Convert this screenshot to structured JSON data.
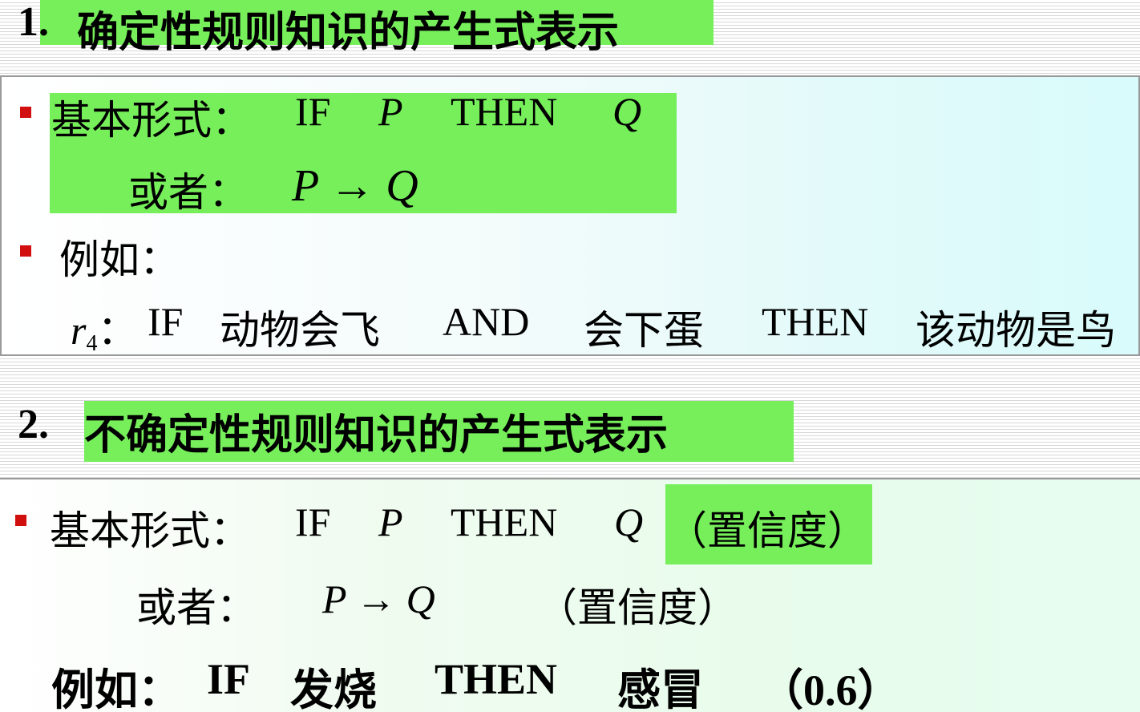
{
  "section1": {
    "number": "1.",
    "title": "确定性规则知识的产生式表示",
    "basic_label": "基本形式：",
    "if_kw": "IF",
    "p": "P",
    "then_kw": "THEN",
    "q": "Q",
    "or_label": "或者：",
    "arrow_expr": "P → Q",
    "example_label": "例如：",
    "example_r": "r",
    "example_sub": "4",
    "example_sep": "：",
    "example_if": "IF",
    "example_cond1": "动物会飞",
    "example_and": "AND",
    "example_cond2": "会下蛋",
    "example_then": "THEN",
    "example_result": "该动物是鸟"
  },
  "section2": {
    "number": "2.",
    "title": "不确定性规则知识的产生式表示",
    "basic_label": "基本形式：",
    "if_kw": "IF",
    "p": "P",
    "then_kw": "THEN",
    "q": "Q",
    "confidence": "（置信度）",
    "or_label": "或者：",
    "arrow_expr": "P → Q",
    "confidence2": "（置信度）",
    "example_label": "例如：",
    "example_if": "IF",
    "example_cond": "发烧",
    "example_then": "THEN",
    "example_result": "感冒",
    "example_value": "（0.6）"
  },
  "colors": {
    "highlight": "#76ef5b",
    "bullet": "#d10f0f"
  }
}
